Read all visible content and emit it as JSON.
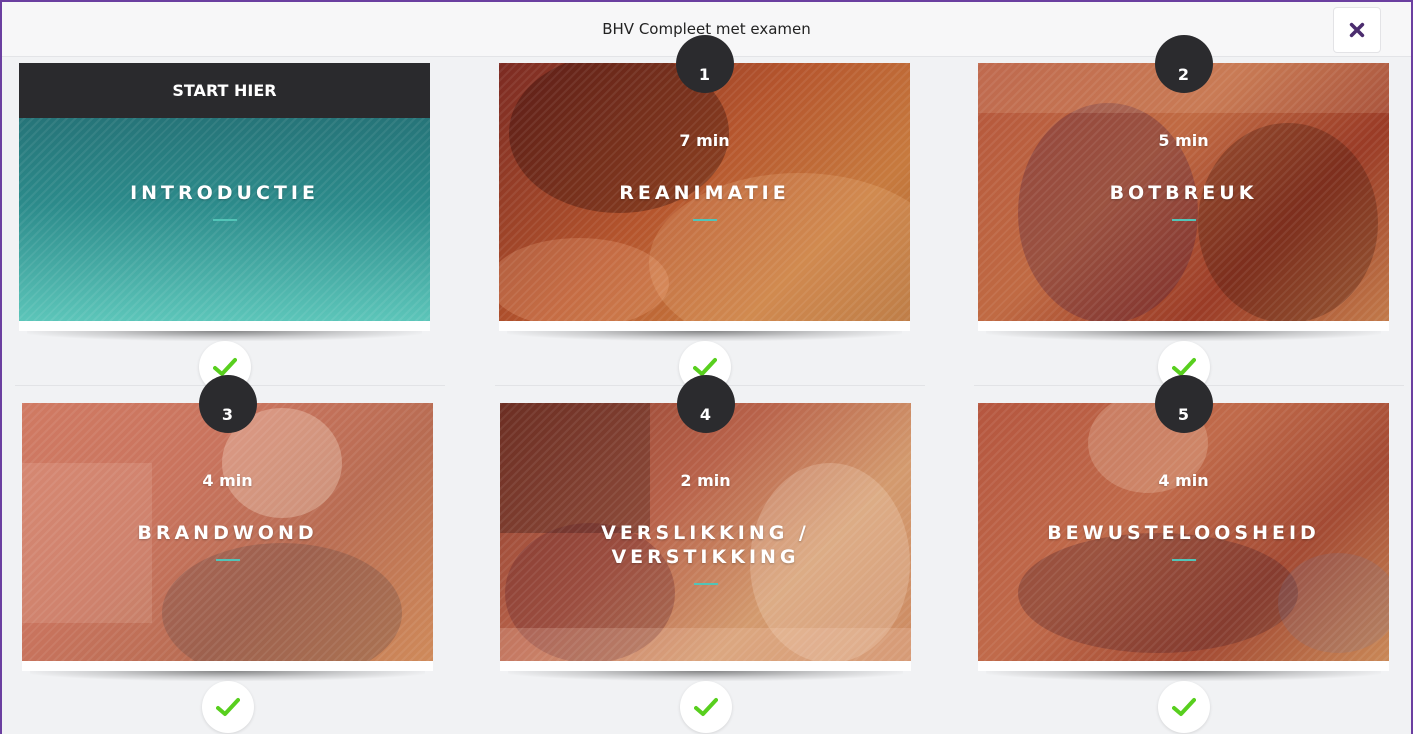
{
  "header": {
    "title": "BHV Compleet met examen"
  },
  "intro": {
    "banner": "START HIER",
    "title": "INTRODUCTIE"
  },
  "modules": [
    {
      "number": "1",
      "duration": "7 min",
      "title": "REANIMATIE",
      "completed": true
    },
    {
      "number": "2",
      "duration": "5 min",
      "title": "BOTBREUK",
      "completed": true
    },
    {
      "number": "3",
      "duration": "4 min",
      "title": "BRANDWOND",
      "completed": true
    },
    {
      "number": "4",
      "duration": "2 min",
      "title_line1": "VERSLIKKING /",
      "title_line2": "VERSTIKKING",
      "completed": true
    },
    {
      "number": "5",
      "duration": "4 min",
      "title": "BEWUSTELOOSHEID",
      "completed": true
    }
  ],
  "intro_completed": true,
  "icons": {
    "close": "close-icon",
    "check": "check-icon"
  },
  "colors": {
    "accent_teal": "#52c4b7",
    "check_green": "#58cf1e",
    "close_purple": "#4b2c6e",
    "frame_purple": "#6b3fa0",
    "badge_dark": "#2b2b2e"
  }
}
